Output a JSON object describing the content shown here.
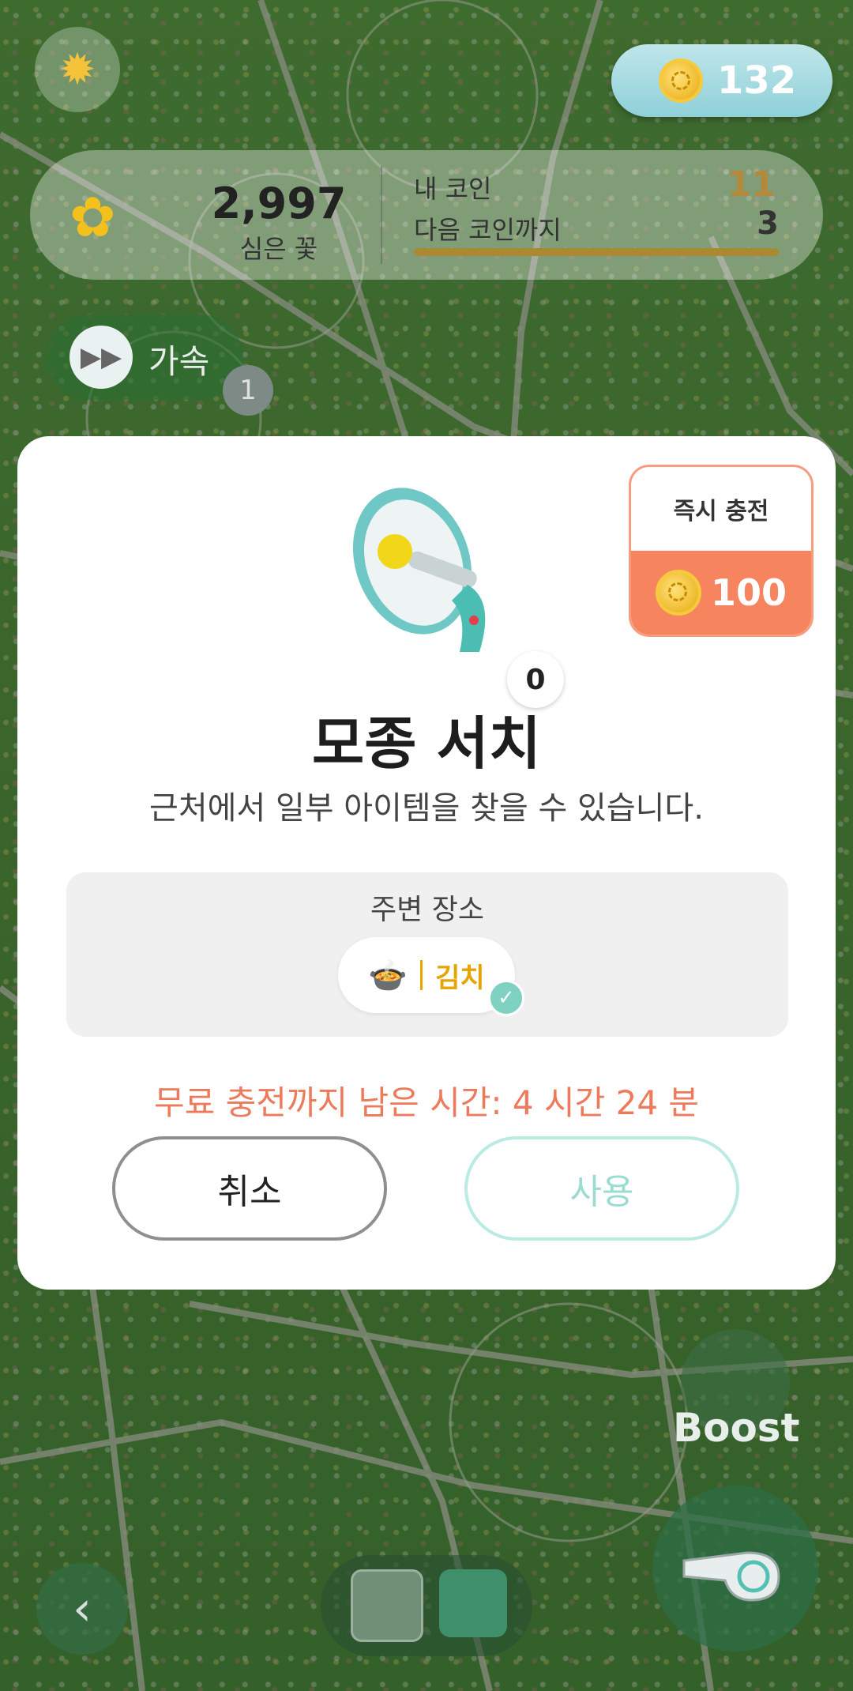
{
  "hud": {
    "coins": "132",
    "planted_count": "2,997",
    "planted_label": "심은 꽃",
    "my_coin_label": "내 코인",
    "next_coin_label": "다음 코인까지",
    "my_coin_value": "11",
    "next_coin_value": "3",
    "speed_label": "가속",
    "speed_badge": "1",
    "boost_label": "Boost",
    "back_icon": "‹"
  },
  "dialog": {
    "instant_charge_label": "즉시 충전",
    "instant_charge_cost": "100",
    "item_quantity": "0",
    "title": "모종 서치",
    "description": "근처에서 일부 아이템을 찾을 수 있습니다.",
    "nearby_label": "주변 장소",
    "nearby_place": "김치",
    "timer_text": "무료 충전까지 남은 시간: 4 시간 24 분",
    "cancel_label": "취소",
    "use_label": "사용"
  },
  "colors": {
    "accent_orange": "#f6845f",
    "accent_teal": "#9adcd0",
    "timer": "#ee7a5c",
    "place_gold": "#e6a400"
  }
}
